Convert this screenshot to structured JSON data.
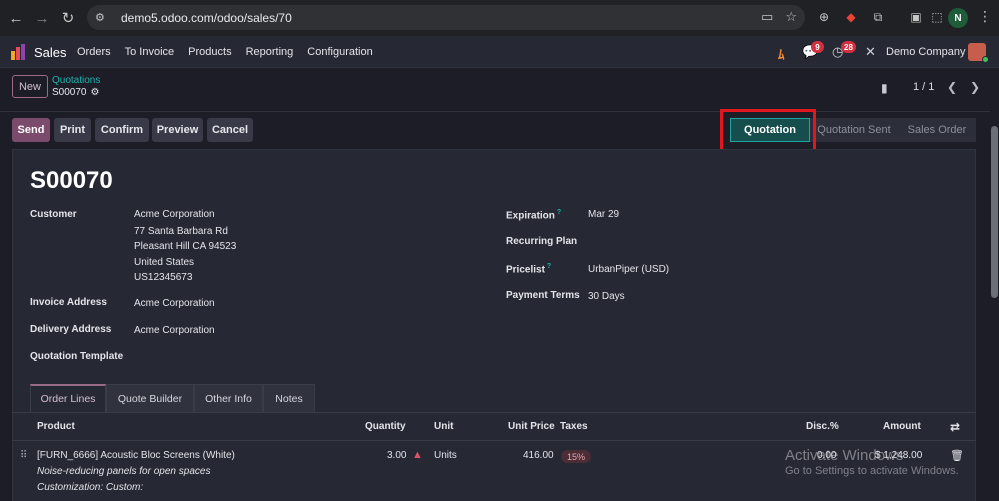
{
  "browser": {
    "url": "demo5.odoo.com/odoo/sales/70",
    "profile_initial": "N",
    "icons": [
      "back-icon",
      "forward-icon",
      "reload-icon",
      "tune-icon",
      "install-icon",
      "star-icon",
      "extensions-icon",
      "menu-icon"
    ]
  },
  "nav": {
    "app_name": "Sales",
    "menu": [
      "Orders",
      "To Invoice",
      "Products",
      "Reporting",
      "Configuration"
    ],
    "messages_count": "9",
    "activities_count": "28",
    "company": "Demo Company"
  },
  "breadcrumb": {
    "new_label": "New",
    "parent": "Quotations",
    "current": "S00070"
  },
  "pager": {
    "value": "1 / 1"
  },
  "actions": [
    "Send",
    "Print",
    "Confirm",
    "Preview",
    "Cancel"
  ],
  "statusbar": {
    "stages": [
      "Quotation",
      "Quotation Sent",
      "Sales Order"
    ],
    "active": "Quotation"
  },
  "record": {
    "name": "S00070",
    "customer_label": "Customer",
    "customer": [
      "Acme Corporation",
      "77 Santa Barbara Rd",
      "Pleasant Hill CA 94523",
      "United States",
      "US12345673"
    ],
    "invoice_address_label": "Invoice Address",
    "invoice_address": "Acme Corporation",
    "delivery_address_label": "Delivery Address",
    "delivery_address": "Acme Corporation",
    "quotation_template_label": "Quotation Template",
    "expiration_label": "Expiration",
    "expiration_help": "?",
    "expiration": "Mar 29",
    "recurring_plan_label": "Recurring Plan",
    "pricelist_label": "Pricelist",
    "pricelist_help": "?",
    "pricelist": "UrbanPiper (USD)",
    "payment_terms_label": "Payment Terms",
    "payment_terms": "30 Days"
  },
  "tabs": [
    "Order Lines",
    "Quote Builder",
    "Other Info",
    "Notes"
  ],
  "table": {
    "headers": [
      "Product",
      "Quantity",
      "Unit",
      "Unit Price",
      "Taxes",
      "Disc.%",
      "Amount"
    ],
    "rows": [
      {
        "product": "[FURN_6666] Acoustic Bloc Screens (White)",
        "description": "Noise-reducing panels for open spaces",
        "customization": "Customization: Custom:",
        "quantity": "3.00",
        "unit": "Units",
        "unit_price": "416.00",
        "taxes": "15%",
        "discount": "0.00",
        "amount": "$ 1,248.00"
      }
    ]
  },
  "watermark": {
    "line1": "Activate Windows",
    "line2": "Go to Settings to activate Windows."
  },
  "colors": {
    "primary": "#7a4b6b",
    "active_stage": "#164d4d",
    "teal": "#1fb3ad",
    "highlight": "#e0171f"
  }
}
